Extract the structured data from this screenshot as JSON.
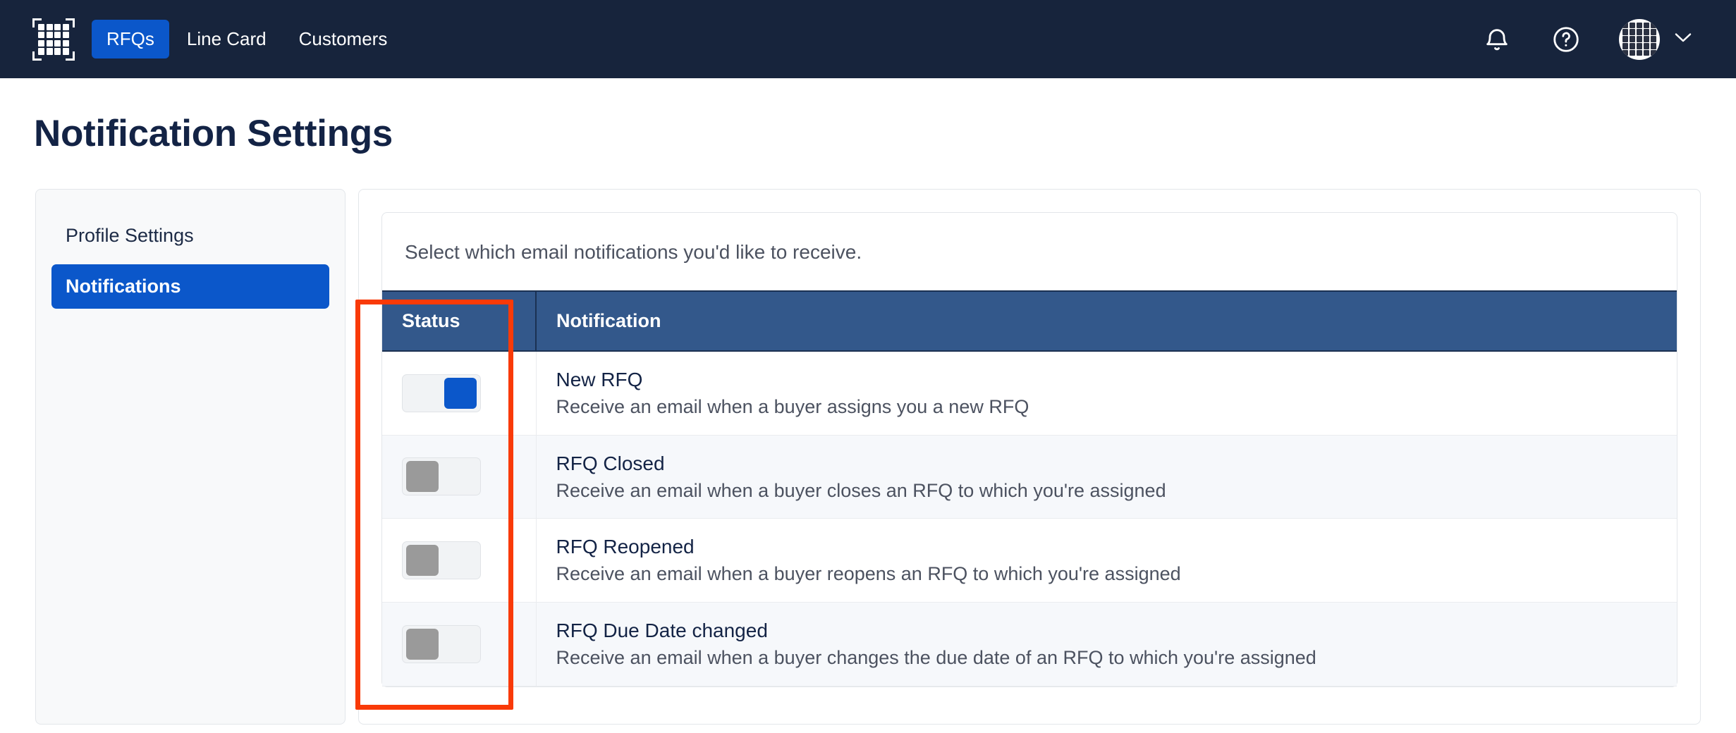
{
  "topnav": {
    "logo_name": "grid-logo",
    "items": [
      {
        "label": "RFQs",
        "active": true
      },
      {
        "label": "Line Card",
        "active": false
      },
      {
        "label": "Customers",
        "active": false
      }
    ],
    "notifications_icon": "bell-icon",
    "help_icon": "question-circle-icon",
    "avatar_icon": "user-avatar-grid",
    "account_chevron": "chevron-down-icon",
    "accent_blue": "#0b57ca",
    "bar_background": "#17243c"
  },
  "page": {
    "title": "Notification Settings"
  },
  "sidebar": {
    "items": [
      {
        "label": "Profile Settings",
        "active": false
      },
      {
        "label": "Notifications",
        "active": true
      }
    ]
  },
  "panel": {
    "intro": "Select which email notifications you'd like to receive.",
    "table": {
      "columns": [
        "Status",
        "Notification"
      ],
      "header_background": "#33588b",
      "rows": [
        {
          "enabled": true,
          "toggle_state": "on",
          "title": "New RFQ",
          "description": "Receive an email when a buyer assigns you a new RFQ"
        },
        {
          "enabled": false,
          "toggle_state": "off",
          "title": "RFQ Closed",
          "description": "Receive an email when a buyer closes an RFQ to which you're assigned"
        },
        {
          "enabled": false,
          "toggle_state": "off",
          "title": "RFQ Reopened",
          "description": "Receive an email when a buyer reopens an RFQ to which you're assigned"
        },
        {
          "enabled": false,
          "toggle_state": "off",
          "title": "RFQ Due Date changed",
          "description": "Receive an email when a buyer changes the due date of an RFQ to which you're assigned"
        }
      ]
    }
  },
  "annotation": {
    "color": "#f93a08",
    "target": "status-column"
  }
}
